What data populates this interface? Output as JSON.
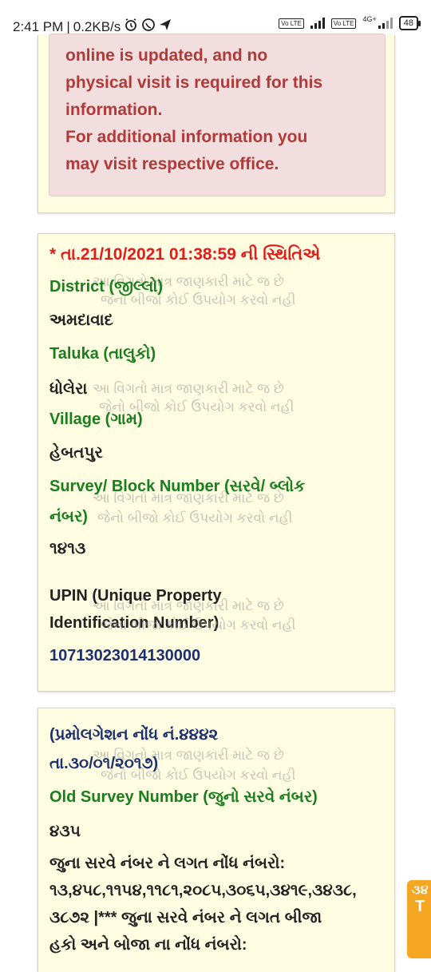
{
  "status_bar": {
    "time": "2:41 PM",
    "speed": "0.2KB/s",
    "network_tag_1": "Vo LTE",
    "network_tag_2": "Vo LTE",
    "network_gen": "4G+",
    "battery": "48"
  },
  "alert": {
    "line1": "online is updated, and no",
    "line2": "physical visit is required for this",
    "line3": "information.",
    "line4": "For additional information you",
    "line5": "may visit respective office."
  },
  "record": {
    "timestamp": "* તા.21/10/2021 01:38:59 ની સ્થિતિએ",
    "district_label": "District (જીલ્લો)",
    "district_value": "અમદાવાદ",
    "taluka_label": "Taluka (તાલુકો)",
    "taluka_value": "ધોલેરા",
    "village_label": "Village (ગામ)",
    "village_value": "હેબતપુર",
    "survey_label_1": "Survey/ Block Number (સરવે/ બ્લોક",
    "survey_label_2": "નંબર)",
    "survey_value": "૧૪૧૩",
    "upin_label_1": "UPIN (Unique Property",
    "upin_label_2": "Identification Number)",
    "upin_value": "10713023014130000"
  },
  "watermark": {
    "line1": "આ વિગતો માત્ર જાણકારી માટે જ છે",
    "line2": "જેનો બીજો કોઈ ઉપયોગ કરવો નહી"
  },
  "old_survey": {
    "note_line1": "(પ્રમોલગેશન નોંધ નં.૪૪૪૨",
    "note_line2": "તા.૩૦/૦૧/૨૦૧૭)",
    "label": "Old Survey Number (જુનો સરવે નંબર)",
    "value": "૪૩૫",
    "entries_line1": "જુના સરવે નંબર ને લગત નોંધ નંબરો:",
    "entries_line2": "૧૩,૪૫૮,૧૧૫૪,૧૧૮૧,૨૦૮૫,૩૦૬૫,૩૪૧૯,૩૪૩૮,",
    "entries_line3": "૩૮૭૨ |*** જુના સરવે નંબર ને લગત બીજા",
    "entries_line4": "હકો અને બોજા ના નોંધ નંબરો:"
  },
  "floating_widget": {
    "text_top": "૩૪",
    "text_mid": "T"
  },
  "colors": {
    "card_bg": "#fefde2",
    "alert_bg": "#f2dede",
    "alert_text": "#b03a37",
    "label_green": "#1a7d1e",
    "timestamp_red": "#e21b1b",
    "upin_navy": "#1c2f6e"
  },
  "icons": [
    "alarm-icon",
    "whatsapp-icon",
    "send-icon",
    "signal-icon",
    "battery-icon"
  ]
}
